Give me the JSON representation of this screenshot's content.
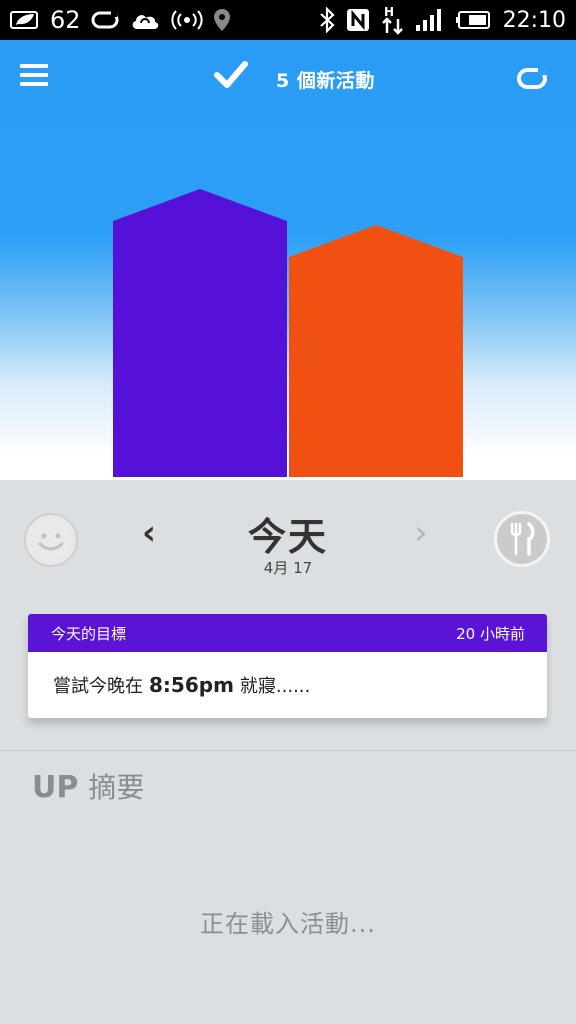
{
  "status_bar": {
    "battery_text": "62",
    "time": "22:10",
    "icons": [
      "leaf-icon",
      "band-icon",
      "cloud-sync-icon",
      "wireless-icon",
      "location-icon",
      "bluetooth-icon",
      "nfc-icon",
      "hspa-icon",
      "signal-icon",
      "battery-icon"
    ]
  },
  "header": {
    "new_activities": "5 個新活動",
    "icons": [
      "menu-icon",
      "check-icon",
      "band-icon"
    ]
  },
  "bars": {
    "colors": {
      "sleep": "#5511d8",
      "move": "#f05012",
      "sky": "#2d9ff6"
    },
    "levels": [
      {
        "name": "sleep",
        "level": 0.72
      },
      {
        "name": "move",
        "level": 0.63
      }
    ]
  },
  "date_nav": {
    "title": "今天",
    "subtitle": "4月 17",
    "prev": "‹",
    "next": "›"
  },
  "goal": {
    "header_left": "今天的目標",
    "header_right": "20 小時前",
    "text_before": "嘗試今晚在",
    "time": "8:56pm",
    "text_after": "就寢......",
    "accent": "#5b13d6"
  },
  "summary": {
    "brand": "UP",
    "title": "摘要",
    "loading": "正在載入活動..."
  }
}
